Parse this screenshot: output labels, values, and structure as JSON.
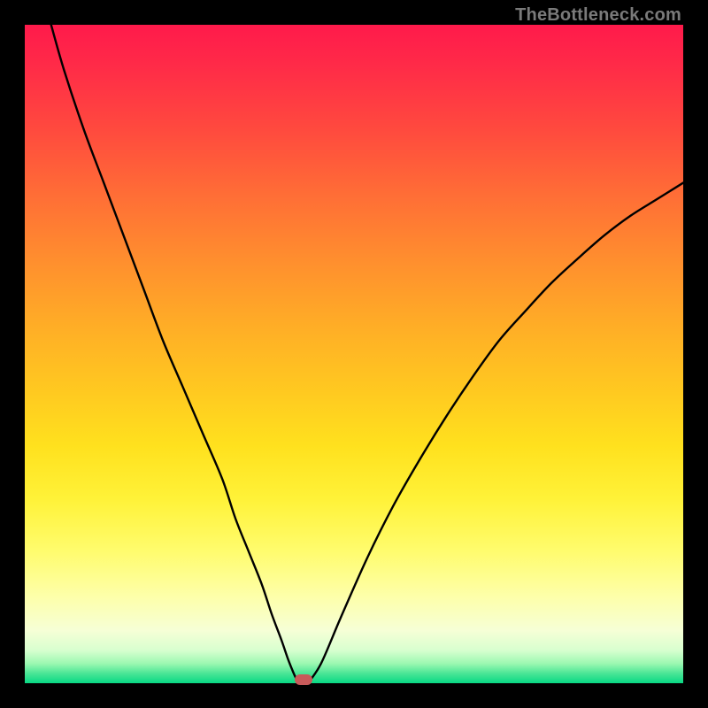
{
  "watermark": "TheBottleneck.com",
  "colors": {
    "frame": "#000000",
    "curve": "#000000",
    "marker": "#c85a5a",
    "gradient_top": "#ff1a4b",
    "gradient_bottom": "#08d884"
  },
  "chart_data": {
    "type": "line",
    "title": "",
    "xlabel": "",
    "ylabel": "",
    "xlim": [
      0,
      100
    ],
    "ylim": [
      0,
      100
    ],
    "left": {
      "x": [
        4,
        6,
        9,
        12,
        15,
        18,
        21,
        24,
        27,
        30,
        32,
        34,
        36,
        37.5,
        39,
        40,
        40.8,
        41.3,
        41.5
      ],
      "y": [
        100,
        93,
        84,
        76,
        68,
        60,
        52,
        45,
        38,
        31,
        25,
        20,
        15,
        10.5,
        6.5,
        3.6,
        1.6,
        0.5,
        0
      ]
    },
    "right": {
      "x": [
        43,
        45,
        48,
        52,
        56,
        60,
        64,
        68,
        72,
        76,
        80,
        84,
        88,
        92,
        96,
        100
      ],
      "y": [
        0,
        3,
        10,
        19,
        27,
        34,
        40.5,
        46.5,
        52,
        56.5,
        60.8,
        64.5,
        68,
        71,
        73.5,
        76
      ]
    },
    "flat": {
      "x": [
        41.5,
        43
      ],
      "y": [
        0,
        0
      ]
    },
    "marker": {
      "x": 42.3,
      "y": 0.5
    }
  }
}
